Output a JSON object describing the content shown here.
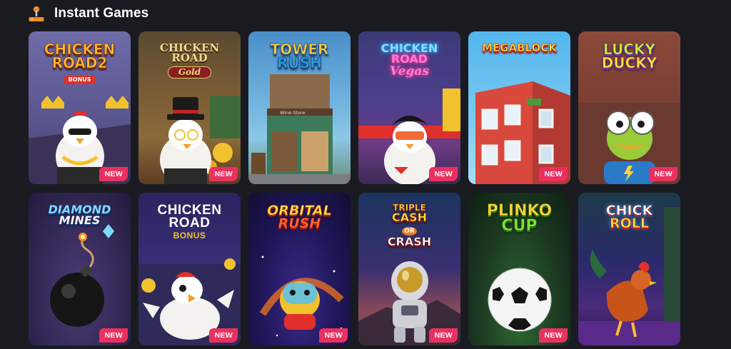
{
  "section": {
    "title": "Instant Games",
    "icon": "joystick-icon"
  },
  "colors": {
    "page_bg": "#1a1b20",
    "badge": "#e8315f",
    "joystick_accent": "#f08a2c"
  },
  "games": [
    {
      "title_lines": [
        "CHICKEN",
        "ROAD2"
      ],
      "subtitle": "BONUS",
      "badge": "NEW"
    },
    {
      "title_lines": [
        "CHICKEN ROAD"
      ],
      "subtitle": "Gold",
      "badge": "NEW"
    },
    {
      "title_lines": [
        "TOWER",
        "RUSH"
      ],
      "sign": "Wine Store",
      "badge": "NEW"
    },
    {
      "title_lines": [
        "CHICKEN",
        "ROAD"
      ],
      "subtitle": "Vegas",
      "badge": "NEW"
    },
    {
      "title_lines": [
        "MEGABLOCK"
      ],
      "badge": "NEW"
    },
    {
      "title_lines": [
        "LUCKY",
        "DUCKY"
      ],
      "badge": "NEW"
    },
    {
      "title_lines": [
        "DIAMOND",
        "MINES"
      ],
      "badge": "NEW"
    },
    {
      "title_lines": [
        "CHICKEN",
        "ROAD"
      ],
      "subtitle": "BONUS",
      "badge": "NEW"
    },
    {
      "title_lines": [
        "ORBITAL",
        "RUSH"
      ],
      "badge": "NEW"
    },
    {
      "title_lines": [
        "TRIPLE",
        "CASH",
        "CRASH"
      ],
      "subtitle": "OR",
      "badge": "NEW"
    },
    {
      "title_lines": [
        "PLINKO",
        "CUP"
      ],
      "badge": "NEW"
    },
    {
      "title_lines": [
        "CHICK",
        "ROLL"
      ],
      "badge": "NEW"
    }
  ]
}
